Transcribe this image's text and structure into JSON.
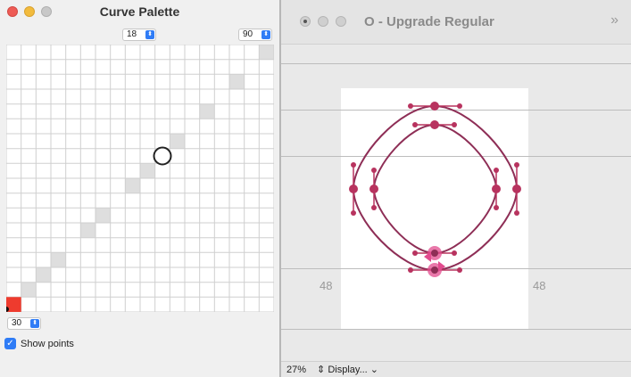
{
  "palette": {
    "title": "Curve Palette",
    "stepper_top_left": "18",
    "stepper_top_right": "90",
    "stepper_bottom": "30",
    "show_points_label": "Show points",
    "show_points_checked": true
  },
  "glyph_window": {
    "title": "O - Upgrade Regular",
    "sidebearing_left": "48",
    "sidebearing_right": "48",
    "zoom": "27%",
    "display_menu": "Display..."
  },
  "colors": {
    "accent": "#2f7cf6",
    "curve": "#8e2e56",
    "node": "#b8335f",
    "selected": "#e24b8e",
    "corner_red": "#ee3b2e"
  }
}
